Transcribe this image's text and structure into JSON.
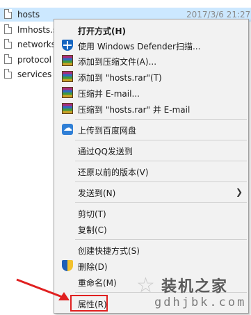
{
  "files": [
    {
      "name": "hosts",
      "date": "2017/3/6 21:27",
      "selected": true
    },
    {
      "name": "lmhosts.s",
      "date": "",
      "selected": false
    },
    {
      "name": "networks",
      "date": "",
      "selected": false
    },
    {
      "name": "protocol",
      "date": "",
      "selected": false
    },
    {
      "name": "services",
      "date": "",
      "selected": false
    }
  ],
  "menu": {
    "open_with": "打开方式(H)",
    "defender_scan": "使用 Windows Defender扫描...",
    "add_archive": "添加到压缩文件(A)...",
    "add_rar": "添加到 \"hosts.rar\"(T)",
    "compress_email": "压缩并 E-mail...",
    "compress_rar_email": "压缩到 \"hosts.rar\" 并 E-mail",
    "upload_baidu": "上传到百度网盘",
    "send_qq": "通过QQ发送到",
    "restore_version": "还原以前的版本(V)",
    "send_to": "发送到(N)",
    "cut": "剪切(T)",
    "copy": "复制(C)",
    "create_shortcut": "创建快捷方式(S)",
    "delete": "删除(D)",
    "rename": "重命名(M)",
    "properties": "属性(R)"
  },
  "watermark": {
    "title": "装机之家",
    "url": "gdhjbk.com"
  },
  "colors": {
    "selected_row": "#cce8ff",
    "menu_bg": "#f2f2f2",
    "highlight": "#e02020"
  },
  "icons": {
    "defender": "defender-shield-icon",
    "winrar": "winrar-icon",
    "baidu": "baidu-cloud-icon",
    "uac": "uac-shield-icon",
    "submenu": "chevron-right-icon"
  }
}
